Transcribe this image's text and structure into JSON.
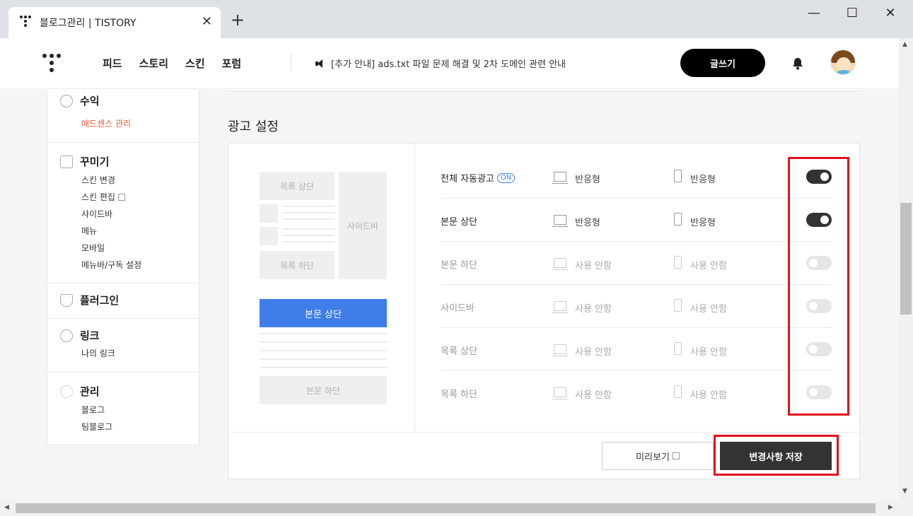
{
  "browser": {
    "tab_title": "블로그관리 | TISTORY",
    "new_tab": "+",
    "close": "✕",
    "minimize": "—",
    "maximize": "☐",
    "win_close": "✕"
  },
  "header": {
    "nav": [
      "피드",
      "스토리",
      "스킨",
      "포럼"
    ],
    "notice": "[추가 안내] ads.txt 파일 문제 해결 및 2차 도메인 관련 안내",
    "write_button": "글쓰기"
  },
  "sidebar": {
    "groups": [
      {
        "title": "수익",
        "icon": "coins-icon",
        "items": [
          "애드센스 관리"
        ]
      },
      {
        "title": "꾸미기",
        "icon": "layout-icon",
        "items": [
          "스킨 변경",
          "스킨 편집",
          "사이드바",
          "메뉴",
          "모바일",
          "메뉴바/구독 설정"
        ]
      },
      {
        "title": "플러그인",
        "icon": "plug-icon",
        "items": []
      },
      {
        "title": "링크",
        "icon": "link-icon",
        "items": [
          "나의 링크"
        ]
      },
      {
        "title": "관리",
        "icon": "gear-icon",
        "items": [
          "블로그",
          "팀블로그"
        ]
      }
    ],
    "active_item": "애드센스 관리"
  },
  "ad_settings": {
    "title": "광고 설정",
    "preview": {
      "list_top": "목록 상단",
      "sidebar": "사이드바",
      "list_bottom": "목록 하단",
      "body_top": "본문 상단",
      "body_bottom": "본문 하단"
    },
    "on_badge": "ON",
    "rows": [
      {
        "label": "전체 자동광고",
        "pc": "반응형",
        "mobile": "반응형",
        "enabled": true
      },
      {
        "label": "본문 상단",
        "pc": "반응형",
        "mobile": "반응형",
        "enabled": true
      },
      {
        "label": "본문 하단",
        "pc": "사용 안함",
        "mobile": "사용 안함",
        "enabled": false
      },
      {
        "label": "사이드바",
        "pc": "사용 안함",
        "mobile": "사용 안함",
        "enabled": false
      },
      {
        "label": "목록 상단",
        "pc": "사용 안함",
        "mobile": "사용 안함",
        "enabled": false
      },
      {
        "label": "목록 하단",
        "pc": "사용 안함",
        "mobile": "사용 안함",
        "enabled": false
      }
    ],
    "preview_button": "미리보기",
    "save_button": "변경사항 저장"
  },
  "colors": {
    "accent_blue": "#3f7ee8",
    "active_red": "#ee5a3b",
    "highlight_red": "#e0121b"
  }
}
